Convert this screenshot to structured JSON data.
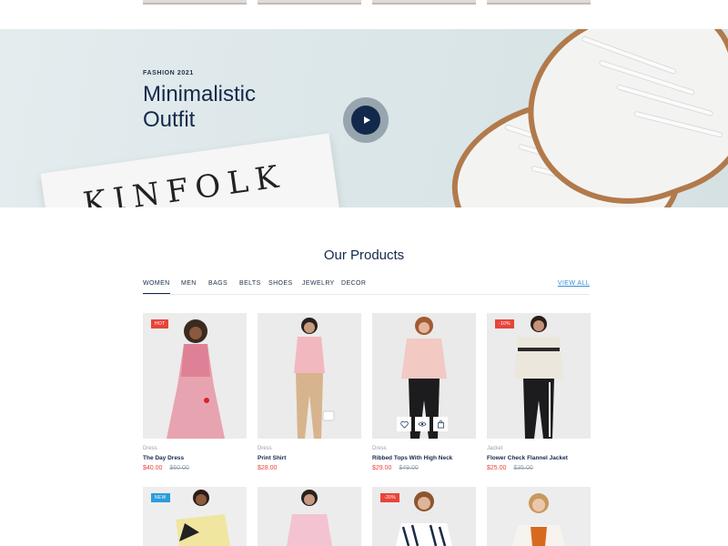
{
  "hero": {
    "kicker": "FASHION 2021",
    "title_line1": "Minimalistic",
    "title_line2": "Outfit",
    "magazine_text": "KINFOLK"
  },
  "section": {
    "title": "Our Products"
  },
  "tabs": [
    {
      "label": "WOMEN",
      "active": true
    },
    {
      "label": "MEN"
    },
    {
      "label": "BAGS"
    },
    {
      "label": "BELTS"
    },
    {
      "label": "SHOES"
    },
    {
      "label": "JEWELRY"
    },
    {
      "label": "DECOR"
    }
  ],
  "view_all": "VIEW ALL",
  "products": [
    {
      "badge": "HOT",
      "badge_color": "#e8443a",
      "category": "Dress",
      "name": "The Day Dress",
      "price": "$40.00",
      "old_price": "$60.00"
    },
    {
      "badge": "",
      "category": "Dress",
      "name": "Print Shirt",
      "price": "$28.00",
      "old_price": ""
    },
    {
      "badge": "",
      "category": "Dress",
      "name": "Ribbed Tops With High Neck",
      "price": "$29.00",
      "old_price": "$49.00"
    },
    {
      "badge": "-10%",
      "badge_color": "#e8443a",
      "category": "Jacket",
      "name": "Flower Check Flannel Jacket",
      "price": "$25.00",
      "old_price": "$35.00"
    }
  ],
  "products_row2": [
    {
      "badge": "NEW",
      "badge_color": "#2d9cdb"
    },
    {
      "badge": ""
    },
    {
      "badge": "-20%",
      "badge_color": "#e8443a"
    },
    {
      "badge": ""
    }
  ],
  "icons": {
    "play": "play-icon",
    "wishlist": "heart-icon",
    "quickview": "eye-icon",
    "cart": "bag-icon"
  },
  "colors": {
    "navy": "#13294b",
    "sale": "#e8443a",
    "link": "#3a8ed8",
    "new": "#2d9cdb"
  }
}
